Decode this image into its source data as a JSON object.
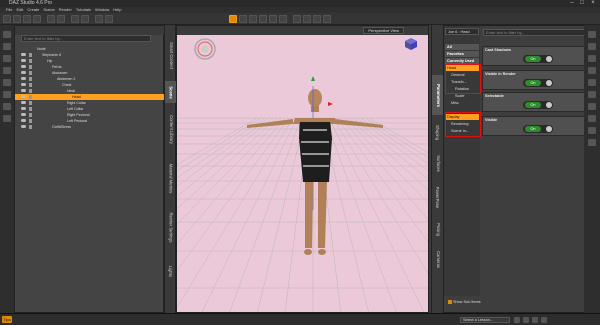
{
  "window": {
    "title": "DAZ Studio 4.6 Pro"
  },
  "menu": [
    "File",
    "Edit",
    "Create",
    "Scene",
    "Render",
    "Tutorials",
    "Window",
    "Help"
  ],
  "scene_pane": {
    "filter_placeholder": "Enter text to filter by...",
    "tree": [
      {
        "label": "Node",
        "indent": 0,
        "selected": false
      },
      {
        "label": "Stephanie 6",
        "indent": 1,
        "selected": false
      },
      {
        "label": "Hip",
        "indent": 2,
        "selected": false
      },
      {
        "label": "Pelvis",
        "indent": 3,
        "selected": false
      },
      {
        "label": "Abdomen",
        "indent": 3,
        "selected": false
      },
      {
        "label": "Abdomen 2",
        "indent": 4,
        "selected": false
      },
      {
        "label": "Chest",
        "indent": 5,
        "selected": false
      },
      {
        "label": "Neck",
        "indent": 6,
        "selected": false
      },
      {
        "label": "Head",
        "indent": 7,
        "selected": true
      },
      {
        "label": "Right Collar",
        "indent": 6,
        "selected": false
      },
      {
        "label": "Left Collar",
        "indent": 6,
        "selected": false
      },
      {
        "label": "Right Pectoral",
        "indent": 6,
        "selected": false
      },
      {
        "label": "Left Pectoral",
        "indent": 6,
        "selected": false
      },
      {
        "label": "Outfit/Dress",
        "indent": 3,
        "selected": false
      }
    ]
  },
  "left_tabs": [
    "Smart Content",
    "Scene",
    "Content Library",
    "Material Metrics",
    "Render Settings",
    "Lights"
  ],
  "left_tabs_active": "Scene",
  "viewport": {
    "camera": "Perspective View"
  },
  "param_tabs": [
    "Parameters",
    "Shaping",
    "Surfaces",
    "PowerPose",
    "Posing",
    "Cameras"
  ],
  "param_tabs_active": "Parameters",
  "parameters": {
    "node_selector": "Joe 6 : Head",
    "filter_placeholder": "Enter text to filter by...",
    "list": [
      {
        "label": "All",
        "style": "hl"
      },
      {
        "label": "Favorites",
        "style": "hl"
      },
      {
        "label": "Currently Used",
        "style": "hl"
      },
      {
        "label": "Head",
        "style": "sel"
      },
      {
        "label": "General",
        "style": ""
      },
      {
        "label": "Transfo...",
        "style": ""
      },
      {
        "label": "Rotation",
        "style": ""
      },
      {
        "label": "Scale",
        "style": ""
      },
      {
        "label": "Misc",
        "style": ""
      },
      {
        "label": "Display",
        "style": "sel"
      },
      {
        "label": "Rendering",
        "style": ""
      },
      {
        "label": "Scene In...",
        "style": ""
      }
    ],
    "properties": [
      {
        "name": "Cast Shadows",
        "value": "On"
      },
      {
        "name": "Visible in Render",
        "value": "On"
      },
      {
        "name": "Selectable",
        "value": "On"
      },
      {
        "name": "Visible",
        "value": "On"
      }
    ],
    "show_sub_items": "Show Sub Items"
  },
  "status": {
    "tips": "Tips",
    "lesson": "Select a Lesson..."
  }
}
